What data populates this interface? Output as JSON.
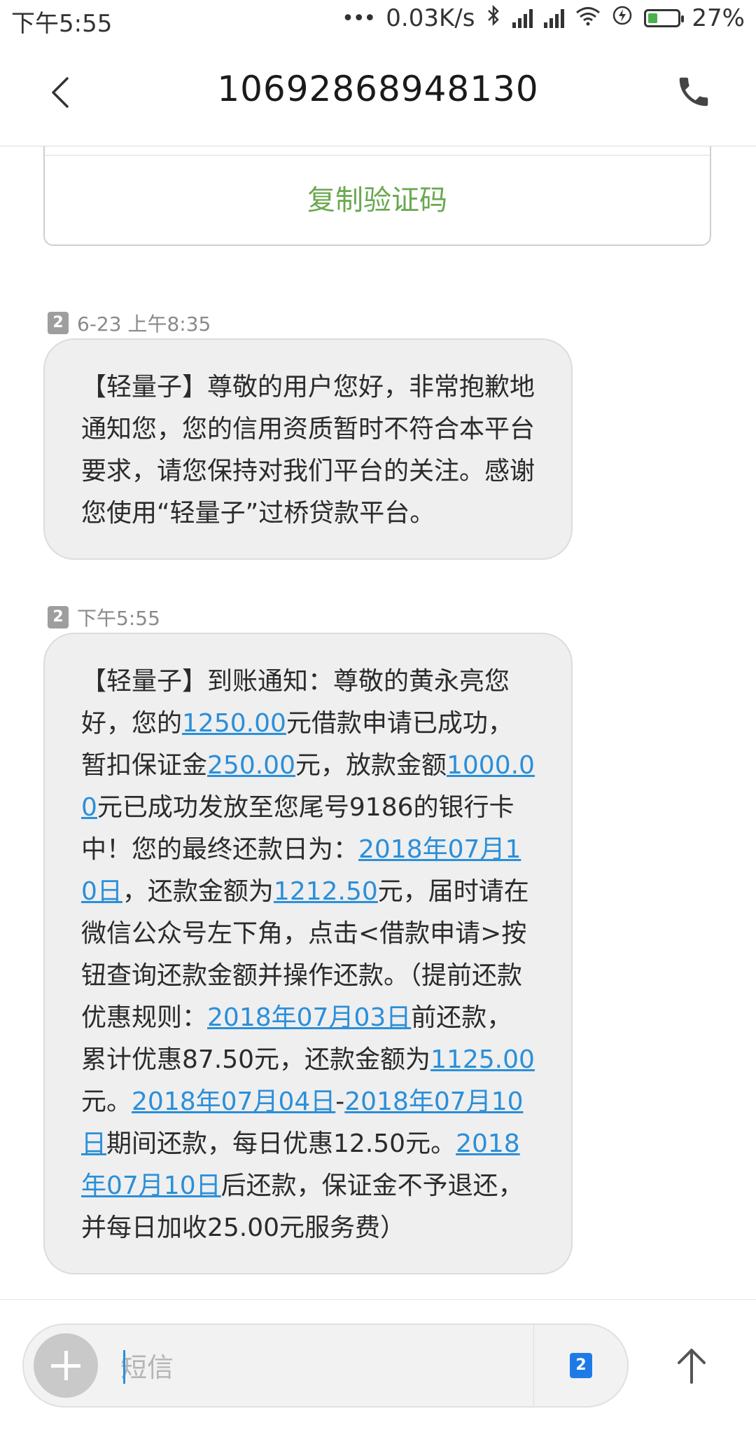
{
  "status_bar": {
    "time": "下午5:55",
    "dots": "•••",
    "net_speed": "0.03K/s",
    "battery_percent": "27%",
    "battery_level": 0.27,
    "icons": [
      "bluetooth-icon",
      "signal-icon",
      "signal-icon",
      "wifi-icon",
      "flash-icon",
      "battery-charging-icon"
    ]
  },
  "header": {
    "title": "10692868948130",
    "back_icon": "back-arrow-icon",
    "call_icon": "phone-icon"
  },
  "copy_card": {
    "button_label": "复制验证码",
    "accent_color": "#6aa84f"
  },
  "messages": [
    {
      "sim": "2",
      "timestamp": "6-23 上午8:35",
      "parts": [
        {
          "t": "【轻量子】尊敬的用户您好，非常抱歉地通知您，您的信用资质暂时不符合本平台要求，请您保持对我们平台的关注。感谢您使用“轻量子”过桥贷款平台。",
          "link": false
        }
      ]
    },
    {
      "sim": "2",
      "timestamp": "下午5:55",
      "parts": [
        {
          "t": "【轻量子】到账通知：尊敬的黄永亮您好，您的",
          "link": false
        },
        {
          "t": "1250.00",
          "link": true
        },
        {
          "t": "元借款申请已成功，暂扣保证金",
          "link": false
        },
        {
          "t": "250.00",
          "link": true
        },
        {
          "t": "元，放款金额",
          "link": false
        },
        {
          "t": "1000.00",
          "link": true
        },
        {
          "t": "元已成功发放至您尾号9186的银行卡中！您的最终还款日为：",
          "link": false
        },
        {
          "t": "2018年07月10日",
          "link": true
        },
        {
          "t": "，还款金额为",
          "link": false
        },
        {
          "t": "1212.50",
          "link": true
        },
        {
          "t": "元，届时请在微信公众号左下角，点击<借款申请>按钮查询还款金额并操作还款。（提前还款优惠规则：",
          "link": false
        },
        {
          "t": "2018年07月03日",
          "link": true
        },
        {
          "t": "前还款，累计优惠87.50元，还款金额为",
          "link": false
        },
        {
          "t": "1125.00",
          "link": true
        },
        {
          "t": "元。",
          "link": false
        },
        {
          "t": "2018年07月04日",
          "link": true
        },
        {
          "t": "-",
          "link": false
        },
        {
          "t": "2018年07月10日",
          "link": true
        },
        {
          "t": "期间还款，每日优惠12.50元。",
          "link": false
        },
        {
          "t": "2018年07月10日",
          "link": true
        },
        {
          "t": "后还款，保证金不予退还，并每日加收25.00元服务费）",
          "link": false
        }
      ]
    }
  ],
  "composer": {
    "placeholder": "短信",
    "sim": "2",
    "add_icon": "plus-icon",
    "send_icon": "send-arrow-icon"
  },
  "colors": {
    "link": "#2b8fd9",
    "bubble": "#efefef",
    "sim_active": "#1e7be6"
  }
}
